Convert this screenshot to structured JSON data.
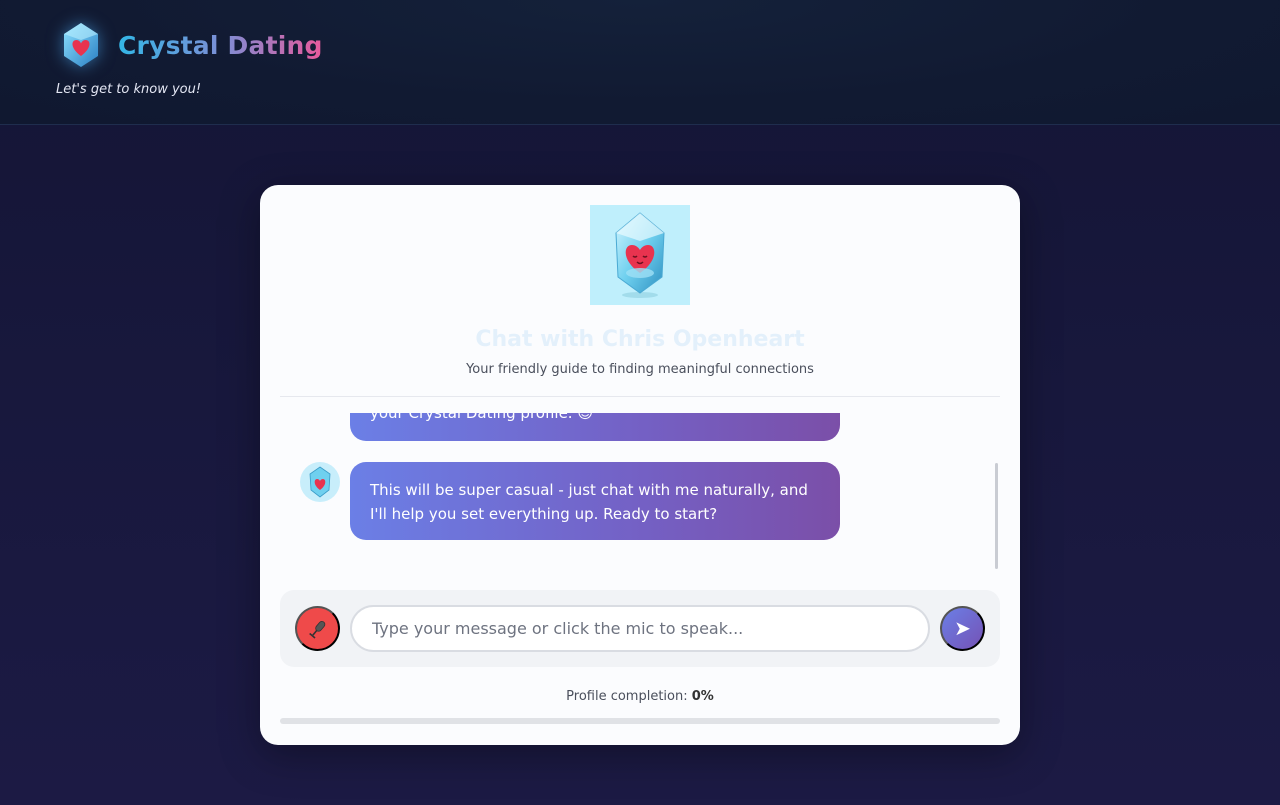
{
  "header": {
    "brand_name": "Crystal Dating",
    "tagline": "Let's get to know you!",
    "logo_icon": "crystal-heart-icon"
  },
  "chat": {
    "title": "Chat with Chris Openheart",
    "subtitle": "Your friendly guide to finding meaningful connections",
    "messages": [
      {
        "sender": "assistant",
        "text": "your Crystal Dating profile. 😊"
      },
      {
        "sender": "assistant",
        "text": "This will be super casual - just chat with me naturally, and I'll help you set everything up. Ready to start?"
      }
    ]
  },
  "composer": {
    "placeholder": "Type your message or click the mic to speak...",
    "value": "",
    "mic_icon": "microphone-icon",
    "send_icon": "send-arrow-icon",
    "send_glyph": "➤"
  },
  "profile": {
    "label": "Profile completion:",
    "value_text": "0%",
    "completion": 0
  },
  "colors": {
    "accent_start": "#6b7fe6",
    "accent_end": "#7b4fa8",
    "mic": "#ef4a4a",
    "background": "#18183d"
  }
}
